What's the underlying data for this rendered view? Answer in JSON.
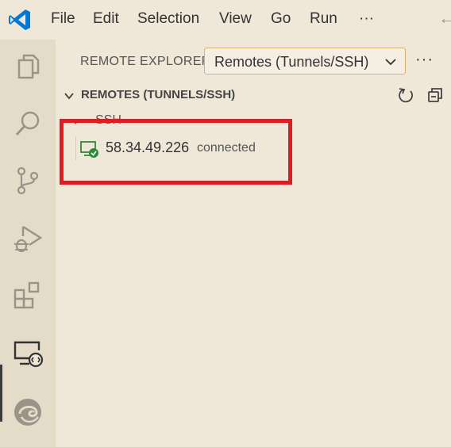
{
  "menu": {
    "items": [
      "File",
      "Edit",
      "Selection",
      "View",
      "Go",
      "Run"
    ],
    "more": "···"
  },
  "activity_bar": {
    "items": [
      "explorer-icon",
      "search-icon",
      "source-control-icon",
      "run-debug-icon",
      "extensions-icon",
      "remote-explorer-icon",
      "edge-icon"
    ],
    "active": "remote-explorer-icon"
  },
  "panel": {
    "title": "REMOTE EXPLORER",
    "dropdown_value": "Remotes (Tunnels/SSH)",
    "more": "···",
    "section_title": "REMOTES (TUNNELS/SSH)",
    "group_label": "SSH",
    "host": {
      "name": "58.34.49.226",
      "status": "connected"
    }
  },
  "colors": {
    "background": "#efe7d7",
    "activity_bar": "#e4dbc9",
    "highlight": "#e01b22",
    "connected": "#2e8b3a",
    "vscode_blue": "#0078d4"
  }
}
